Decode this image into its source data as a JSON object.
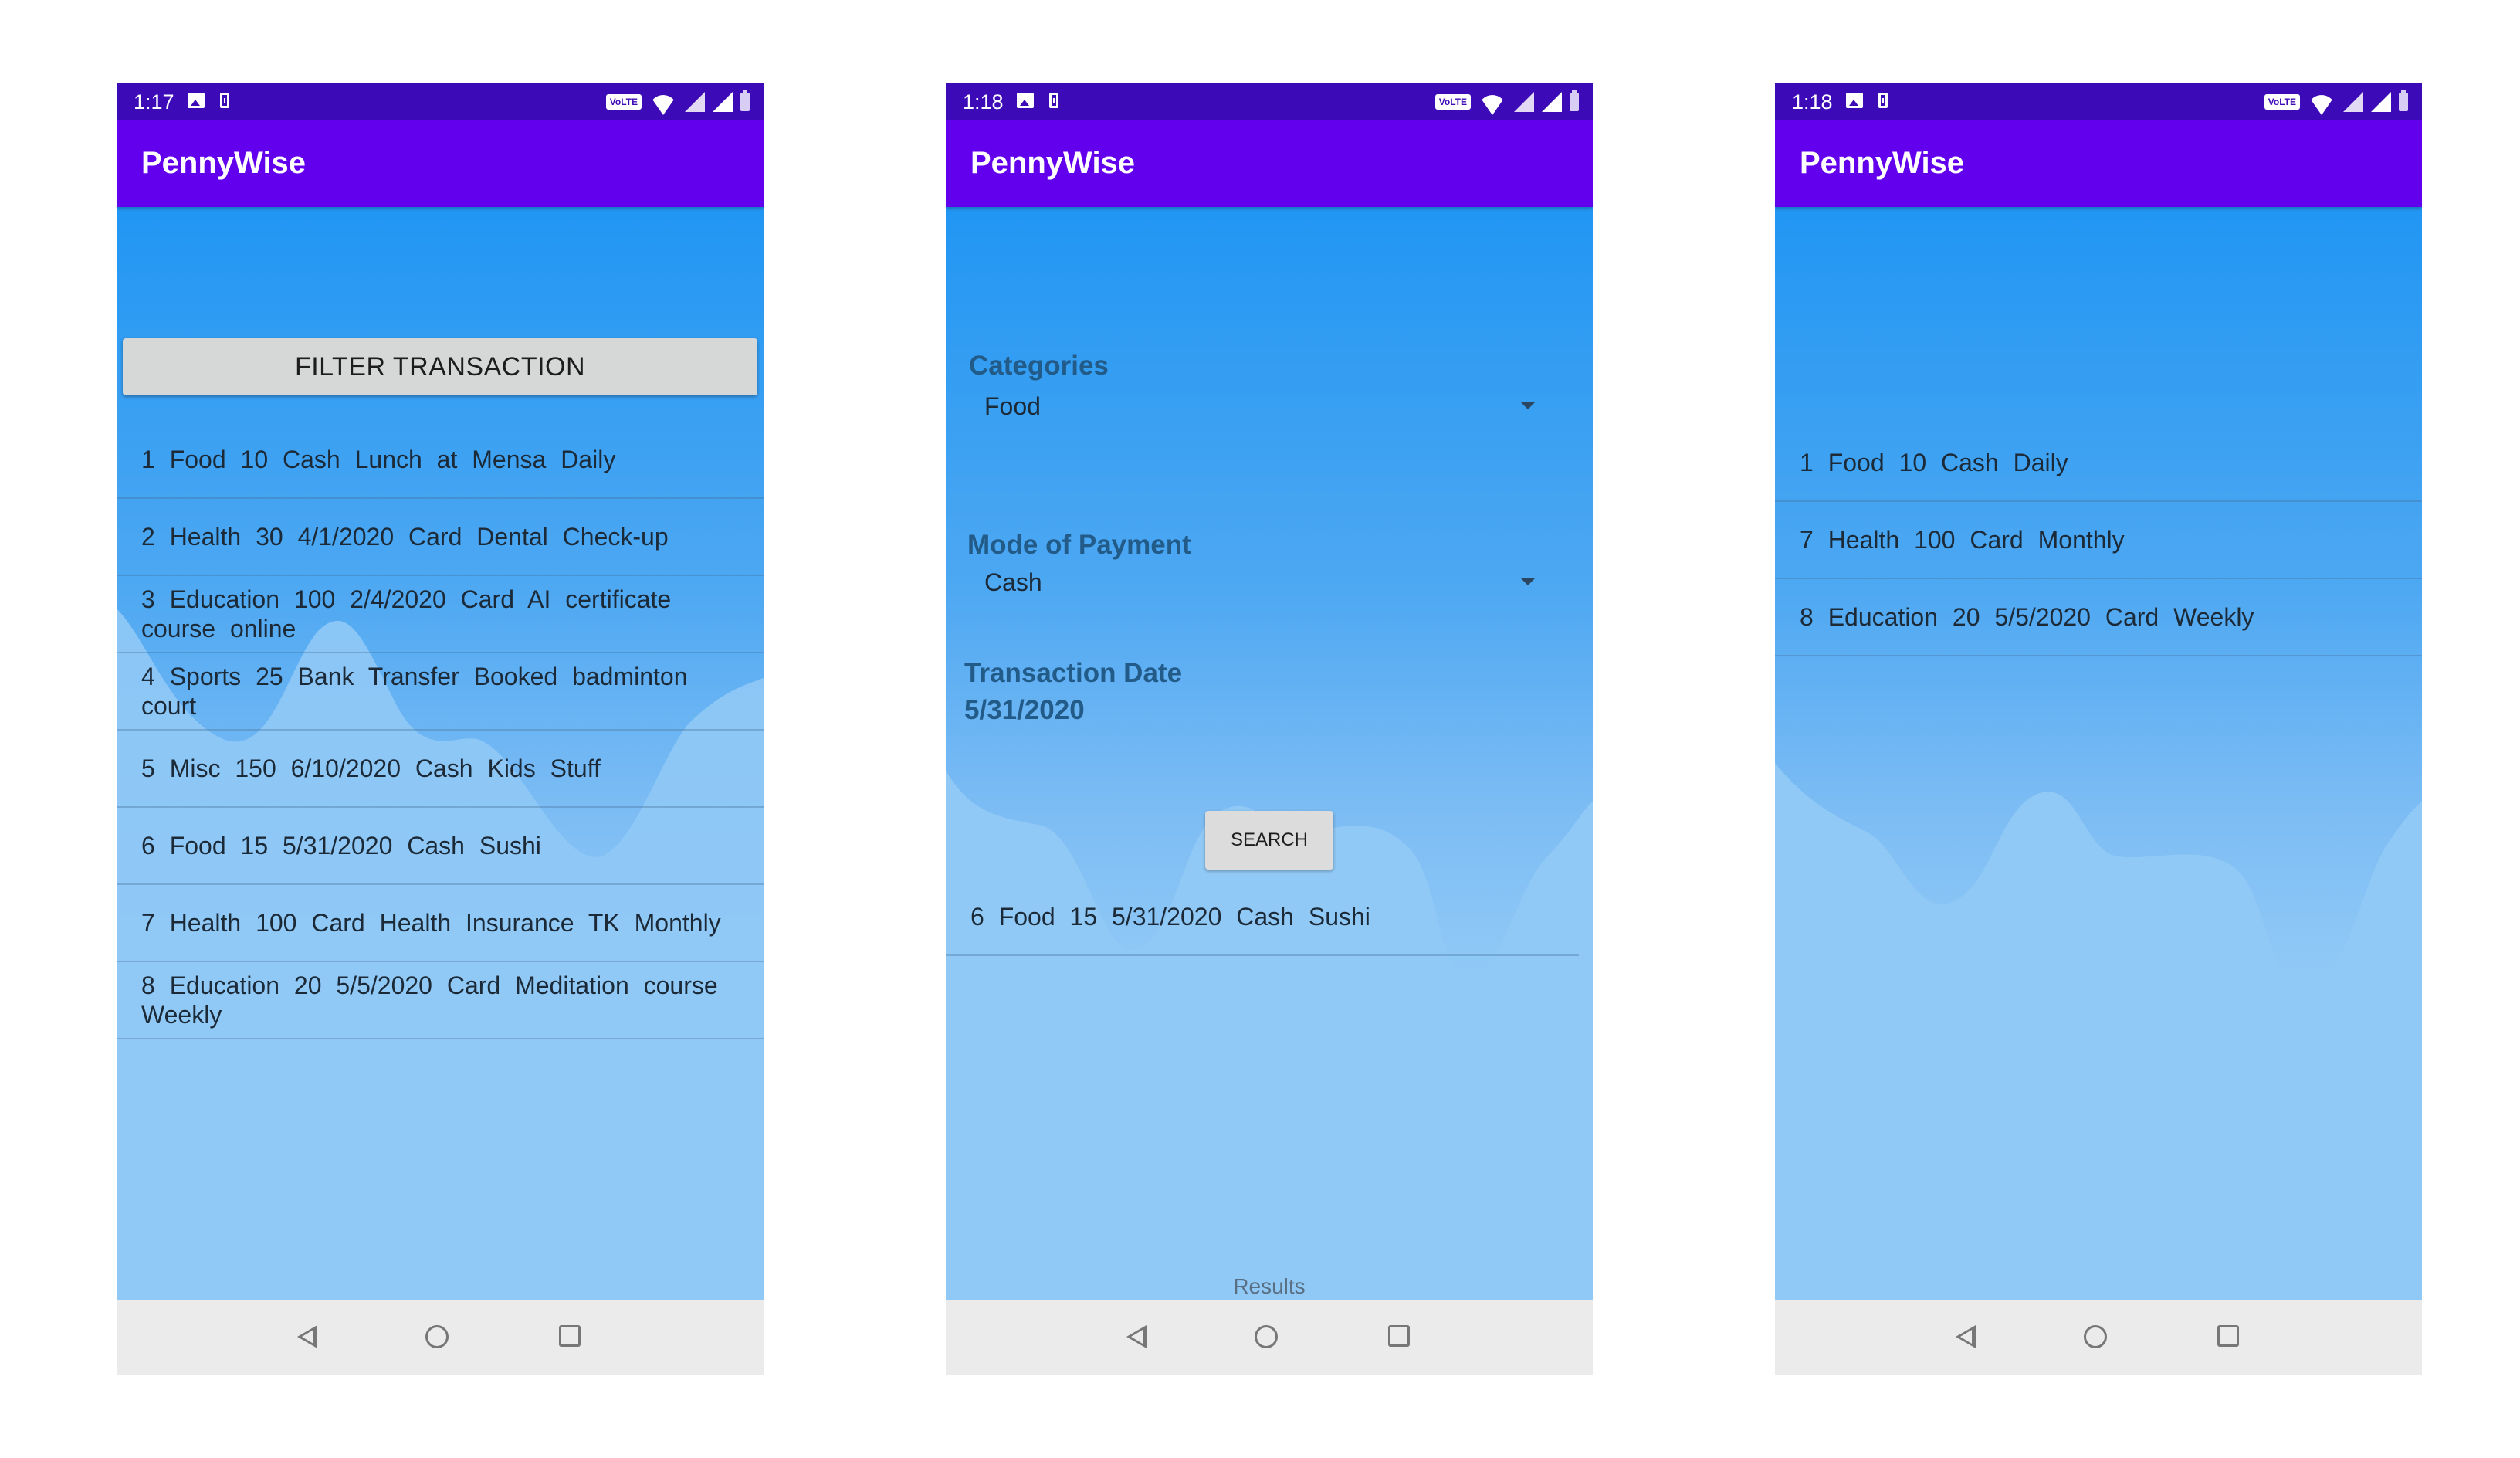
{
  "colors": {
    "status_bar": "#3d0ab8",
    "app_bar": "#6200ee",
    "content_top": "#2196f3",
    "content_bottom": "#90c9f6",
    "nav_bar": "#ebebeb"
  },
  "screens": [
    {
      "status": {
        "time": "1:17",
        "volte": "VoLTE"
      },
      "app_title": "PennyWise",
      "filter_button": "FILTER TRANSACTION",
      "transactions": [
        {
          "text": "1  Food  10     Cash  Lunch at Mensa  Daily"
        },
        {
          "text": "2  Health  30  4/1/2020  Card  Dental Check-up"
        },
        {
          "text": "3  Education  100  2/4/2020  Card  AI certificate course online"
        },
        {
          "text": "4  Sports  25     Bank Transfer  Booked badminton court"
        },
        {
          "text": "5  Misc  150  6/10/2020  Cash  Kids Stuff"
        },
        {
          "text": "6  Food  15  5/31/2020  Cash  Sushi"
        },
        {
          "text": "7  Health  100     Card  Health Insurance TK Monthly"
        },
        {
          "text": "8  Education  20  5/5/2020  Card  Meditation course  Weekly"
        }
      ]
    },
    {
      "status": {
        "time": "1:18",
        "volte": "VoLTE"
      },
      "app_title": "PennyWise",
      "categories_label": "Categories",
      "categories_value": "Food",
      "payment_label": "Mode of Payment",
      "payment_value": "Cash",
      "date_label": "Transaction Date",
      "date_value": "5/31/2020",
      "search_button": "SEARCH",
      "result_row": "6  Food  15  5/31/2020  Cash  Sushi",
      "results_label": "Results"
    },
    {
      "status": {
        "time": "1:18",
        "volte": "VoLTE"
      },
      "app_title": "PennyWise",
      "transactions": [
        {
          "text": "1  Food  10     Cash  Daily"
        },
        {
          "text": "7  Health  100     Card  Monthly"
        },
        {
          "text": "8  Education  20  5/5/2020  Card  Weekly"
        }
      ]
    }
  ],
  "icons": {
    "status_left": [
      "image-icon",
      "sim-icon"
    ],
    "status_right": [
      "volte-icon",
      "wifi-icon",
      "signal-icon",
      "signal-icon",
      "battery-icon"
    ],
    "nav": [
      "back-icon",
      "home-icon",
      "recents-icon"
    ]
  }
}
